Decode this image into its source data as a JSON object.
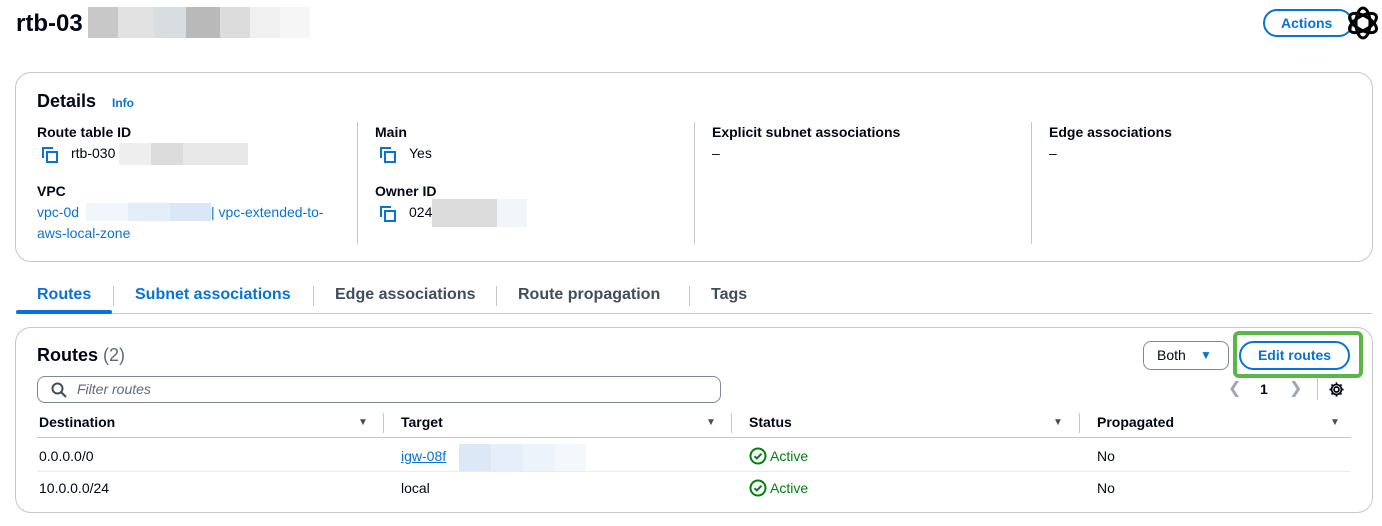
{
  "header": {
    "title": "rtb-03",
    "actions_label": "Actions"
  },
  "details": {
    "title": "Details",
    "info": "Info",
    "route_table_id": {
      "label": "Route table ID",
      "value": "rtb-030"
    },
    "vpc": {
      "label": "VPC",
      "value_line1": "vpc-0d",
      "value_sep": "| vpc-extended-to-",
      "value_line2": "aws-local-zone"
    },
    "main": {
      "label": "Main",
      "value": "Yes"
    },
    "owner_id": {
      "label": "Owner ID",
      "value": "024"
    },
    "explicit_subnet": {
      "label": "Explicit subnet associations",
      "value": "–"
    },
    "edge": {
      "label": "Edge associations",
      "value": "–"
    }
  },
  "tabs": [
    {
      "label": "Routes",
      "active": true
    },
    {
      "label": "Subnet associations"
    },
    {
      "label": "Edge associations"
    },
    {
      "label": "Route propagation"
    },
    {
      "label": "Tags"
    }
  ],
  "routes": {
    "title": "Routes",
    "count": "(2)",
    "filter_select": "Both",
    "edit_label": "Edit routes",
    "filter_placeholder": "Filter routes",
    "page": "1",
    "columns": [
      "Destination",
      "Target",
      "Status",
      "Propagated"
    ],
    "rows": [
      {
        "destination": "0.0.0.0/0",
        "target": "igw-08f",
        "status": "Active",
        "propagated": "No"
      },
      {
        "destination": "10.0.0.0/24",
        "target": "local",
        "status": "Active",
        "propagated": "No"
      }
    ]
  },
  "colors": {
    "accent": "#0972d3",
    "success": "#037f0c",
    "highlight": "#5ab645"
  }
}
